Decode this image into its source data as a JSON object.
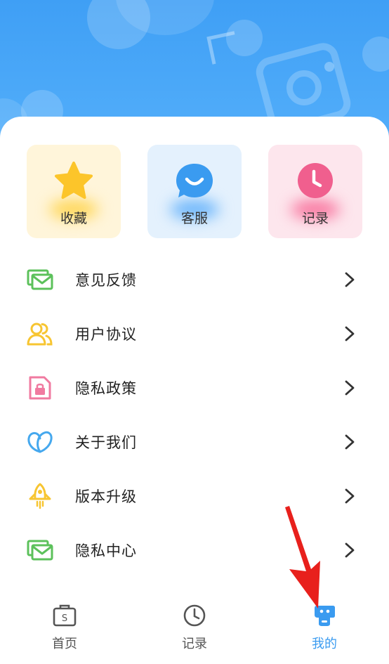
{
  "quick_actions": [
    {
      "label": "收藏",
      "icon": "star-icon"
    },
    {
      "label": "客服",
      "icon": "chat-smile-icon"
    },
    {
      "label": "记录",
      "icon": "clock-icon"
    }
  ],
  "menu": [
    {
      "label": "意见反馈",
      "icon": "mail-icon"
    },
    {
      "label": "用户协议",
      "icon": "users-icon"
    },
    {
      "label": "隐私政策",
      "icon": "lock-document-icon"
    },
    {
      "label": "关于我们",
      "icon": "heart-leaf-icon"
    },
    {
      "label": "版本升级",
      "icon": "rocket-icon"
    },
    {
      "label": "隐私中心",
      "icon": "mail-icon"
    }
  ],
  "tabs": [
    {
      "label": "首页",
      "icon": "briefcase-icon",
      "active": false
    },
    {
      "label": "记录",
      "icon": "clock-icon",
      "active": false
    },
    {
      "label": "我的",
      "icon": "profile-icon",
      "active": true
    }
  ],
  "colors": {
    "header_blue": "#4aa8f8",
    "accent_blue": "#3a9bf0",
    "star_yellow": "#fcc52a",
    "record_pink": "#f05f8e",
    "arrow_red": "#e8201c"
  }
}
